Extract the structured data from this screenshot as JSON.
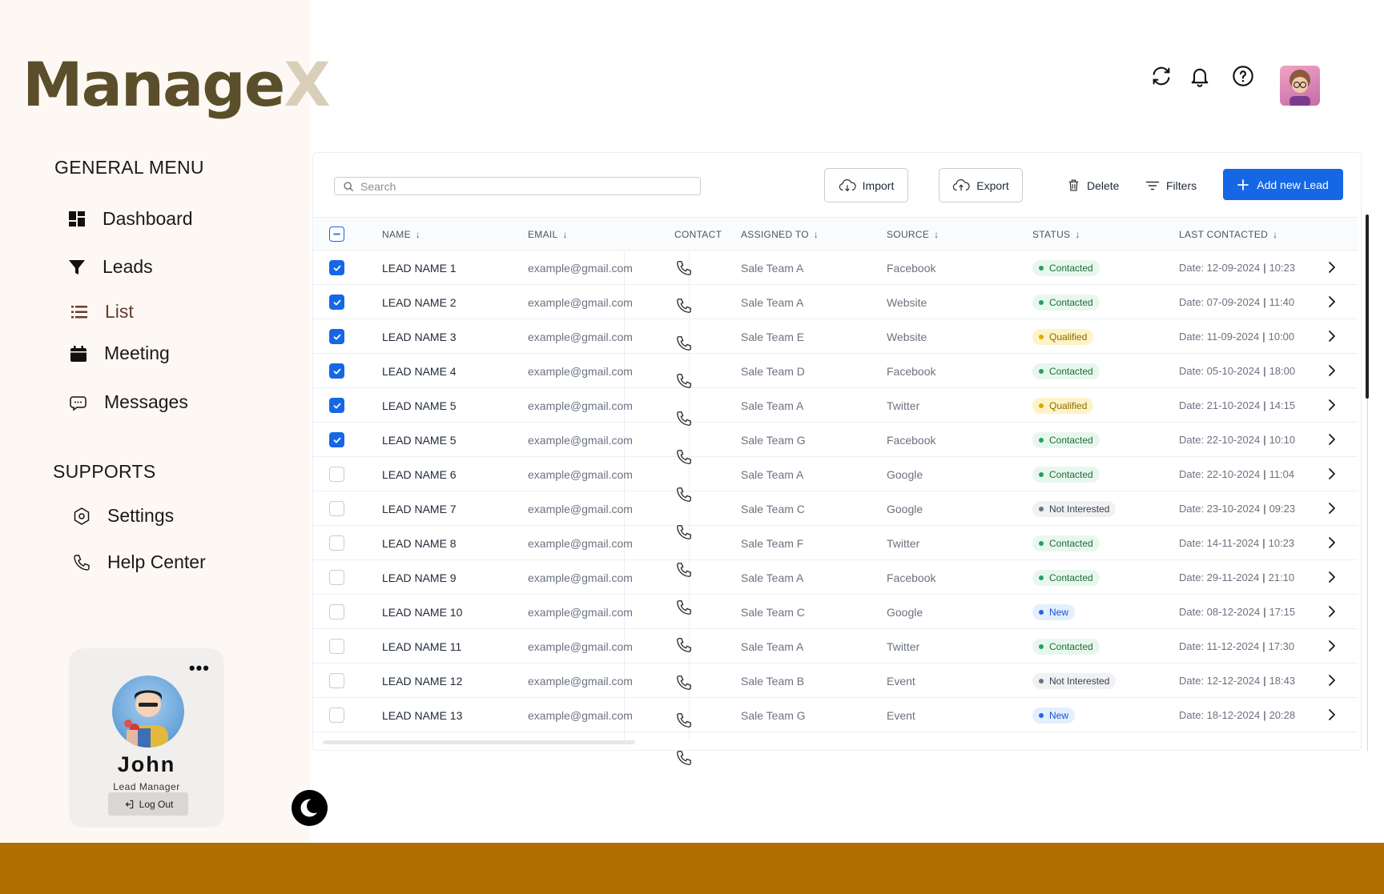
{
  "app": {
    "logo_main": "Manage",
    "logo_x": "X"
  },
  "sidebar": {
    "general_title": "GENERAL MENU",
    "general_items": [
      {
        "label": "Dashboard",
        "icon": "dashboard-icon"
      },
      {
        "label": "Leads",
        "icon": "funnel-icon"
      },
      {
        "label": "List",
        "icon": "list-icon",
        "active": true
      },
      {
        "label": "Meeting",
        "icon": "calendar-icon"
      },
      {
        "label": "Messages",
        "icon": "chat-icon"
      }
    ],
    "supports_title": "SUPPORTS",
    "support_items": [
      {
        "label": "Settings",
        "icon": "settings-icon"
      },
      {
        "label": "Help Center",
        "icon": "phone-icon"
      }
    ],
    "profile": {
      "name": "John",
      "role": "Lead Manager",
      "logout_label": "Log Out"
    }
  },
  "header": {
    "icons": [
      "refresh-icon",
      "bell-icon",
      "help-icon"
    ]
  },
  "toolbar": {
    "search_placeholder": "Search",
    "import_label": "Import",
    "export_label": "Export",
    "delete_label": "Delete",
    "filters_label": "Filters",
    "add_label": "Add new Lead"
  },
  "table": {
    "columns": [
      "NAME",
      "EMAIL",
      "CONTACT",
      "ASSIGNED TO",
      "SOURCE",
      "STATUS",
      "LAST CONTACTED"
    ],
    "rows": [
      {
        "checked": true,
        "name": "LEAD NAME 1",
        "email": "example@gmail.com",
        "assigned": "Sale Team A",
        "source": "Facebook",
        "status": "Contacted",
        "date": "Date: 12-09-2024",
        "time": "10:23"
      },
      {
        "checked": true,
        "name": "LEAD NAME 2",
        "email": "example@gmail.com",
        "assigned": "Sale Team A",
        "source": "Website",
        "status": "Contacted",
        "date": "Date: 07-09-2024",
        "time": "11:40"
      },
      {
        "checked": true,
        "name": "LEAD NAME 3",
        "email": "example@gmail.com",
        "assigned": "Sale Team E",
        "source": "Website",
        "status": "Qualified",
        "date": "Date: 11-09-2024",
        "time": "10:00"
      },
      {
        "checked": true,
        "name": "LEAD NAME 4",
        "email": "example@gmail.com",
        "assigned": "Sale Team D",
        "source": "Facebook",
        "status": "Contacted",
        "date": "Date: 05-10-2024",
        "time": "18:00"
      },
      {
        "checked": true,
        "name": "LEAD NAME 5",
        "email": "example@gmail.com",
        "assigned": "Sale Team A",
        "source": "Twitter",
        "status": "Qualified",
        "date": "Date: 21-10-2024",
        "time": "14:15"
      },
      {
        "checked": true,
        "name": "LEAD NAME 5",
        "email": "example@gmail.com",
        "assigned": "Sale Team G",
        "source": "Facebook",
        "status": "Contacted",
        "date": "Date: 22-10-2024",
        "time": "10:10"
      },
      {
        "checked": false,
        "name": "LEAD NAME 6",
        "email": "example@gmail.com",
        "assigned": "Sale Team A",
        "source": "Google",
        "status": "Contacted",
        "date": "Date: 22-10-2024",
        "time": "11:04"
      },
      {
        "checked": false,
        "name": "LEAD NAME 7",
        "email": "example@gmail.com",
        "assigned": "Sale Team C",
        "source": "Google",
        "status": "Not Interested",
        "date": "Date: 23-10-2024",
        "time": "09:23"
      },
      {
        "checked": false,
        "name": "LEAD NAME 8",
        "email": "example@gmail.com",
        "assigned": "Sale Team F",
        "source": "Twitter",
        "status": "Contacted",
        "date": "Date: 14-11-2024",
        "time": "10:23"
      },
      {
        "checked": false,
        "name": "LEAD NAME 9",
        "email": "example@gmail.com",
        "assigned": "Sale Team A",
        "source": "Facebook",
        "status": "Contacted",
        "date": "Date: 29-11-2024",
        "time": "21:10"
      },
      {
        "checked": false,
        "name": "LEAD NAME 10",
        "email": "example@gmail.com",
        "assigned": "Sale Team C",
        "source": "Google",
        "status": "New",
        "date": "Date: 08-12-2024",
        "time": "17:15"
      },
      {
        "checked": false,
        "name": "LEAD NAME 11",
        "email": "example@gmail.com",
        "assigned": "Sale Team A",
        "source": "Twitter",
        "status": "Contacted",
        "date": "Date: 11-12-2024",
        "time": "17:30"
      },
      {
        "checked": false,
        "name": "LEAD NAME 12",
        "email": "example@gmail.com",
        "assigned": "Sale Team B",
        "source": "Event",
        "status": "Not Interested",
        "date": "Date: 12-12-2024",
        "time": "18:43"
      },
      {
        "checked": false,
        "name": "LEAD NAME 13",
        "email": "example@gmail.com",
        "assigned": "Sale Team G",
        "source": "Event",
        "status": "New",
        "date": "Date: 18-12-2024",
        "time": "20:28"
      }
    ]
  },
  "colors": {
    "accent": "#1567e6",
    "brand": "#5b4f2b",
    "active_nav": "#6b3a2e",
    "footer": "#b06d00"
  }
}
